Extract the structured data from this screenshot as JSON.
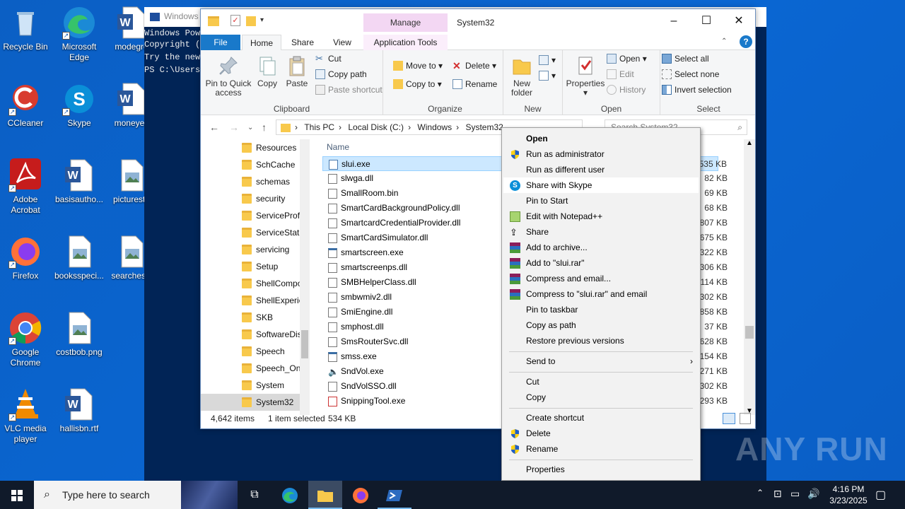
{
  "desktop": {
    "icons": [
      {
        "label": "Recycle Bin"
      },
      {
        "label": "Microsoft Edge"
      },
      {
        "label": "modegro"
      },
      {
        "label": "CCleaner"
      },
      {
        "label": "Skype"
      },
      {
        "label": "moneyec"
      },
      {
        "label": "Adobe Acrobat"
      },
      {
        "label": "basisautho..."
      },
      {
        "label": "picturesta"
      },
      {
        "label": "Firefox"
      },
      {
        "label": "booksspeci..."
      },
      {
        "label": "searchesw"
      },
      {
        "label": "Google Chrome"
      },
      {
        "label": "costbob.png"
      },
      {
        "label": "VLC media player"
      },
      {
        "label": "hallisbn.rtf"
      }
    ]
  },
  "powershell": {
    "title": "Windows",
    "lines": [
      "Windows Pow",
      "Copyright (",
      "",
      "Try the new",
      "",
      "PS C:\\Users"
    ]
  },
  "explorer": {
    "manage_tab": "Manage",
    "window_title": "System32",
    "tabs": [
      "File",
      "Home",
      "Share",
      "View",
      "Application Tools"
    ],
    "ribbon": {
      "pin": "Pin to Quick access",
      "copy": "Copy",
      "paste": "Paste",
      "cut": "Cut",
      "copy_path": "Copy path",
      "paste_shortcut": "Paste shortcut",
      "clipboard": "Clipboard",
      "move_to": "Move to",
      "copy_to": "Copy to",
      "delete": "Delete",
      "rename": "Rename",
      "organize": "Organize",
      "new_folder": "New folder",
      "new": "New",
      "properties": "Properties",
      "open": "Open",
      "edit": "Edit",
      "history": "History",
      "open_group": "Open",
      "select_all": "Select all",
      "select_none": "Select none",
      "invert_selection": "Invert selection",
      "select": "Select"
    },
    "breadcrumb": [
      "This PC",
      "Local Disk (C:)",
      "Windows",
      "System32"
    ],
    "search_placeholder": "Search System32",
    "nav_items": [
      "Resources",
      "SchCache",
      "schemas",
      "security",
      "ServiceProfi",
      "ServiceState",
      "servicing",
      "Setup",
      "ShellCompo",
      "ShellExperie",
      "SKB",
      "SoftwareDis",
      "Speech",
      "Speech_One",
      "System",
      "System32"
    ],
    "column_name": "Name",
    "files": [
      {
        "name": "slui.exe",
        "size": "535 KB"
      },
      {
        "name": "slwga.dll",
        "size": "82 KB"
      },
      {
        "name": "SmallRoom.bin",
        "size": "69 KB"
      },
      {
        "name": "SmartCardBackgroundPolicy.dll",
        "size": "68 KB"
      },
      {
        "name": "SmartcardCredentialProvider.dll",
        "size": "807 KB"
      },
      {
        "name": "SmartCardSimulator.dll",
        "size": "675 KB"
      },
      {
        "name": "smartscreen.exe",
        "size": "322 KB"
      },
      {
        "name": "smartscreenps.dll",
        "size": "306 KB"
      },
      {
        "name": "SMBHelperClass.dll",
        "size": "114 KB"
      },
      {
        "name": "smbwmiv2.dll",
        "size": "302 KB"
      },
      {
        "name": "SmiEngine.dll",
        "size": "858 KB"
      },
      {
        "name": "smphost.dll",
        "size": "37 KB"
      },
      {
        "name": "SmsRouterSvc.dll",
        "size": "628 KB"
      },
      {
        "name": "smss.exe",
        "size": "154 KB"
      },
      {
        "name": "SndVol.exe",
        "size": "271 KB"
      },
      {
        "name": "SndVolSSO.dll",
        "size": "302 KB"
      },
      {
        "name": "SnippingTool.exe",
        "size": "293 KB"
      }
    ],
    "status": {
      "count": "4,642 items",
      "selected": "1 item selected",
      "size": "534 KB"
    }
  },
  "context_menu": [
    "Open",
    "Run as administrator",
    "Run as different user",
    "Share with Skype",
    "Pin to Start",
    "Edit with Notepad++",
    "Share",
    "Add to archive...",
    "Add to \"slui.rar\"",
    "Compress and email...",
    "Compress to \"slui.rar\" and email",
    "Pin to taskbar",
    "Copy as path",
    "Restore previous versions",
    "Send to",
    "Cut",
    "Copy",
    "Create shortcut",
    "Delete",
    "Rename",
    "Properties"
  ],
  "taskbar": {
    "search_placeholder": "Type here to search",
    "time": "4:16 PM",
    "date": "3/23/2025"
  },
  "watermark": "ANY RUN"
}
